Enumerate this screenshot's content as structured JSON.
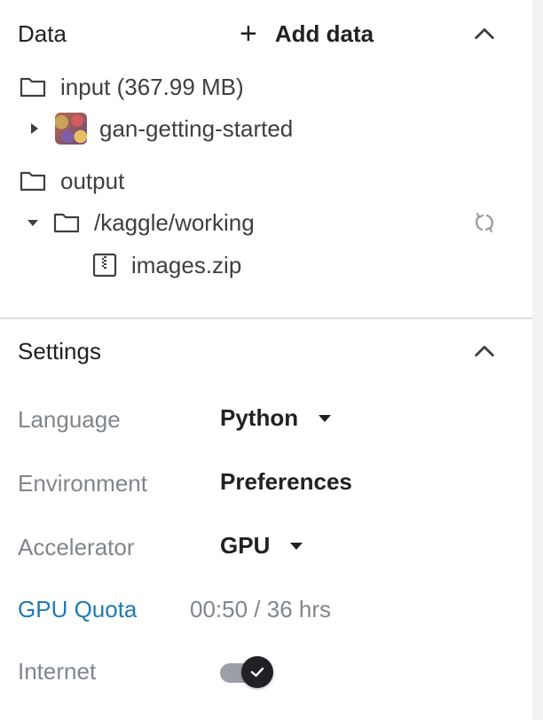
{
  "data_section": {
    "title": "Data",
    "add_data_label": "Add data",
    "input_label": "input (367.99 MB)",
    "dataset_name": "gan-getting-started",
    "output_label": "output",
    "working_dir": "/kaggle/working",
    "file_name": "images.zip"
  },
  "settings_section": {
    "title": "Settings",
    "language_label": "Language",
    "language_value": "Python",
    "environment_label": "Environment",
    "environment_value": "Preferences",
    "accelerator_label": "Accelerator",
    "accelerator_value": "GPU",
    "gpu_quota_label": "GPU Quota",
    "gpu_quota_value": "00:50 / 36 hrs",
    "internet_label": "Internet",
    "internet_enabled": true
  },
  "colors": {
    "link": "#1f7bb3",
    "muted_text": "#80868b",
    "toggle_knob": "#202124"
  },
  "icons": [
    "plus-icon",
    "chevron-up-icon",
    "folder-icon",
    "caret-right-icon",
    "caret-down-icon",
    "refresh-icon",
    "zip-file-icon",
    "dropdown-caret-icon",
    "check-icon"
  ]
}
